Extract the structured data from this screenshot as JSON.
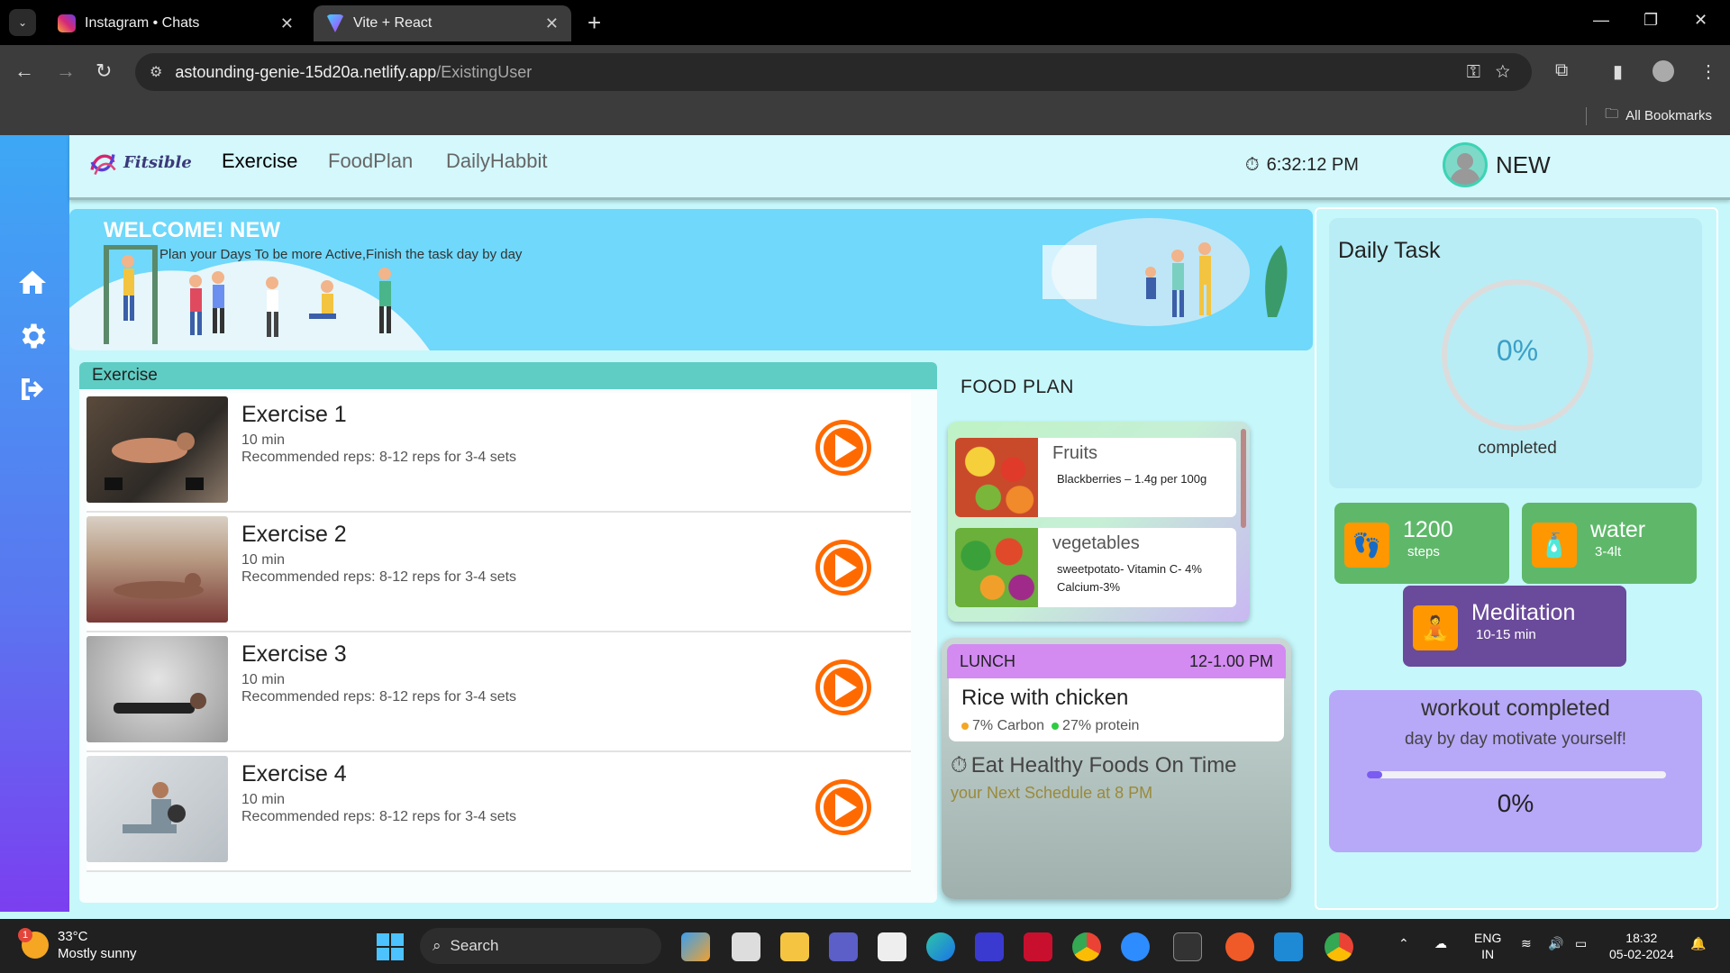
{
  "browser": {
    "tabs": [
      {
        "title": "Instagram • Chats",
        "active": false
      },
      {
        "title": "Vite + React",
        "active": true
      }
    ],
    "url_host": "astounding-genie-15d20a.netlify.app",
    "url_path": "/ExistingUser",
    "bookmarks_label": "All Bookmarks"
  },
  "header": {
    "brand": "Fitsible",
    "nav": [
      "Exercise",
      "FoodPlan",
      "DailyHabbit"
    ],
    "active_nav": "Exercise",
    "time": "6:32:12 PM",
    "username": "NEW"
  },
  "banner": {
    "title": "WELCOME! NEW",
    "subtitle": "Plan your Days To be more Active,Finish the task day by day"
  },
  "exercise": {
    "heading": "Exercise",
    "items": [
      {
        "name": "Exercise 1",
        "duration": "10 min",
        "reps": "Recommended reps: 8-12 reps for 3-4 sets"
      },
      {
        "name": "Exercise 2",
        "duration": "10 min",
        "reps": "Recommended reps: 8-12 reps for 3-4 sets"
      },
      {
        "name": "Exercise 3",
        "duration": "10 min",
        "reps": "Recommended reps: 8-12 reps for 3-4 sets"
      },
      {
        "name": "Exercise 4",
        "duration": "10 min",
        "reps": "Recommended reps: 8-12 reps for 3-4 sets"
      }
    ]
  },
  "food": {
    "heading": "FOOD PLAN",
    "items": [
      {
        "name": "Fruits",
        "desc": "Blackberries – 1.4g per 100g"
      },
      {
        "name": "vegetables",
        "desc": "sweetpotato- Vitamin C- 4% Calcium-3%"
      }
    ],
    "lunch": {
      "label": "LUNCH",
      "time": "12-1.00 PM",
      "dish": "Rice with chicken",
      "carb": "7% Carbon",
      "protein": "27% protein"
    },
    "reminder_title": "Eat Healthy Foods On Time",
    "reminder_sub": "your Next Schedule at 8 PM"
  },
  "daily": {
    "title": "Daily Task",
    "percent": "0%",
    "completed_label": "completed",
    "steps_value": "1200",
    "steps_label": "steps",
    "water_value": "water",
    "water_label": "3-4lt",
    "meditation_value": "Meditation",
    "meditation_label": "10-15 min",
    "workout_title": "workout completed",
    "workout_sub": "day by day motivate yourself!",
    "workout_percent": "0%",
    "workout_progress": 0.05
  },
  "taskbar": {
    "weather_temp": "33°C",
    "weather_desc": "Mostly sunny",
    "weather_badge": "1",
    "search_label": "Search",
    "lang1": "ENG",
    "lang2": "IN",
    "clock_time": "18:32",
    "clock_date": "05-02-2024"
  },
  "colors": {
    "accent_orange": "#ff6a00",
    "steps_green": "#5fb86a",
    "meditation_purple": "#6a4a9a",
    "workout_lavender": "#b8a8f8"
  }
}
